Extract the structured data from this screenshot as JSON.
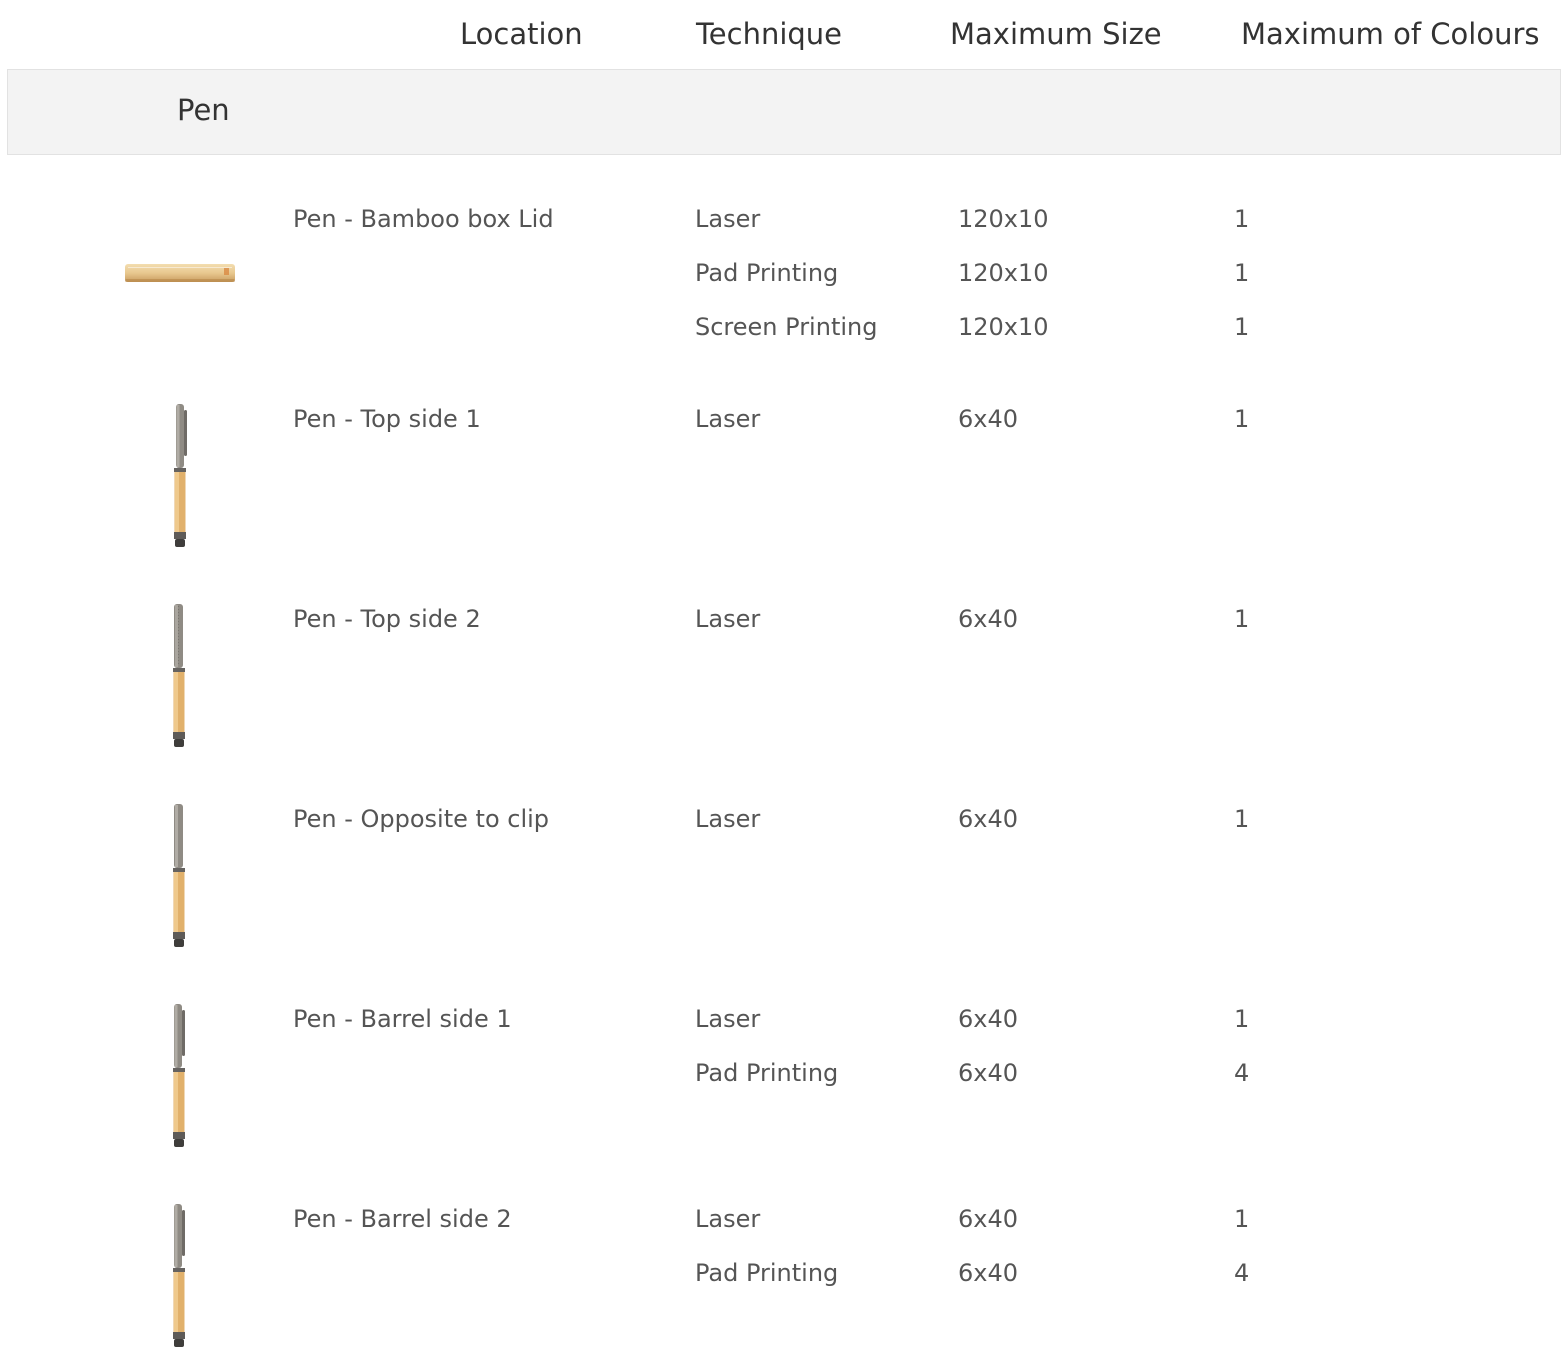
{
  "headers": {
    "location": "Location",
    "technique": "Technique",
    "max_size": "Maximum Size",
    "max_colours": "Maximum of Colours"
  },
  "group": {
    "title": "Pen"
  },
  "rows": [
    {
      "location": "Pen - Bamboo box Lid",
      "thumbnail": "bamboo-box-lid-image",
      "techniques": [
        {
          "technique": "Laser",
          "size": "120x10",
          "colours": "1"
        },
        {
          "technique": "Pad Printing",
          "size": "120x10",
          "colours": "1"
        },
        {
          "technique": "Screen Printing",
          "size": "120x10",
          "colours": "1"
        }
      ]
    },
    {
      "location": "Pen - Top side 1",
      "thumbnail": "pen-image",
      "techniques": [
        {
          "technique": "Laser",
          "size": "6x40",
          "colours": "1"
        }
      ]
    },
    {
      "location": "Pen - Top side 2",
      "thumbnail": "pen-image",
      "techniques": [
        {
          "technique": "Laser",
          "size": "6x40",
          "colours": "1"
        }
      ]
    },
    {
      "location": "Pen - Opposite to clip",
      "thumbnail": "pen-image",
      "techniques": [
        {
          "technique": "Laser",
          "size": "6x40",
          "colours": "1"
        }
      ]
    },
    {
      "location": "Pen - Barrel side 1",
      "thumbnail": "pen-image",
      "techniques": [
        {
          "technique": "Laser",
          "size": "6x40",
          "colours": "1"
        },
        {
          "technique": "Pad Printing",
          "size": "6x40",
          "colours": "4"
        }
      ]
    },
    {
      "location": "Pen - Barrel side 2",
      "thumbnail": "pen-image",
      "techniques": [
        {
          "technique": "Laser",
          "size": "6x40",
          "colours": "1"
        },
        {
          "technique": "Pad Printing",
          "size": "6x40",
          "colours": "4"
        }
      ]
    }
  ]
}
